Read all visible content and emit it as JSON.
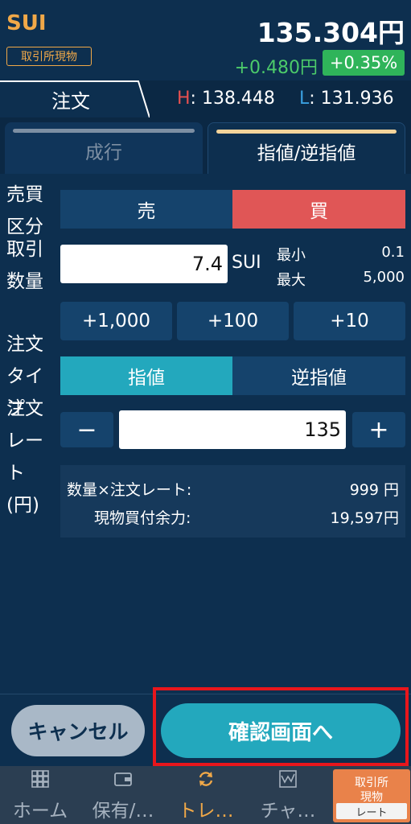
{
  "header": {
    "symbol": "SUI",
    "market": "取引所現物",
    "price": "135.304円",
    "change_amount": "+0.480円",
    "change_pct": "+0.35%"
  },
  "tabbar": {
    "order_tab": "注文",
    "high_label": "H",
    "high_value": ": 138.448",
    "low_label": "L",
    "low_value": ": 131.936"
  },
  "order_type_tabs": {
    "market": "成行",
    "limit": "指値/逆指値",
    "selected": "limit"
  },
  "form": {
    "side": {
      "label": "売買区分",
      "sell": "売",
      "buy": "買",
      "selected": "buy"
    },
    "quantity": {
      "label": "取引数量",
      "value": "7.4",
      "unit": "SUI",
      "min_label": "最小",
      "min_value": "0.1",
      "max_label": "最大",
      "max_value": "5,000",
      "steps": [
        "+1,000",
        "+100",
        "+10"
      ]
    },
    "order_kind": {
      "label": "注文タイプ",
      "limit": "指値",
      "stop": "逆指値",
      "selected": "limit"
    },
    "rate": {
      "label": "注文レート(円)",
      "value": "135",
      "minus": "−",
      "plus": "+"
    },
    "summary": {
      "amount_label": "数量×注文レート:",
      "amount_value": "999 円",
      "balance_label": "現物買付余力:",
      "balance_value": "19,597円"
    }
  },
  "actions": {
    "cancel": "キャンセル",
    "confirm": "確認画面へ"
  },
  "nav": {
    "items": [
      {
        "label": "ホーム",
        "icon": "grid-icon"
      },
      {
        "label": "保有/…",
        "icon": "wallet-icon"
      },
      {
        "label": "トレ…",
        "icon": "refresh-icon"
      },
      {
        "label": "チャ…",
        "icon": "chart-icon"
      }
    ],
    "active": 2,
    "rate_badge": {
      "line1": "取引所",
      "line2": "現物",
      "line3": "レート"
    }
  },
  "colors": {
    "background": "#0d2f4f",
    "accent_orange": "#f0a848",
    "up_green": "#4ccb6a",
    "buy_red": "#e05656",
    "teal": "#23a8bd",
    "highlight_red": "#e8161c"
  }
}
